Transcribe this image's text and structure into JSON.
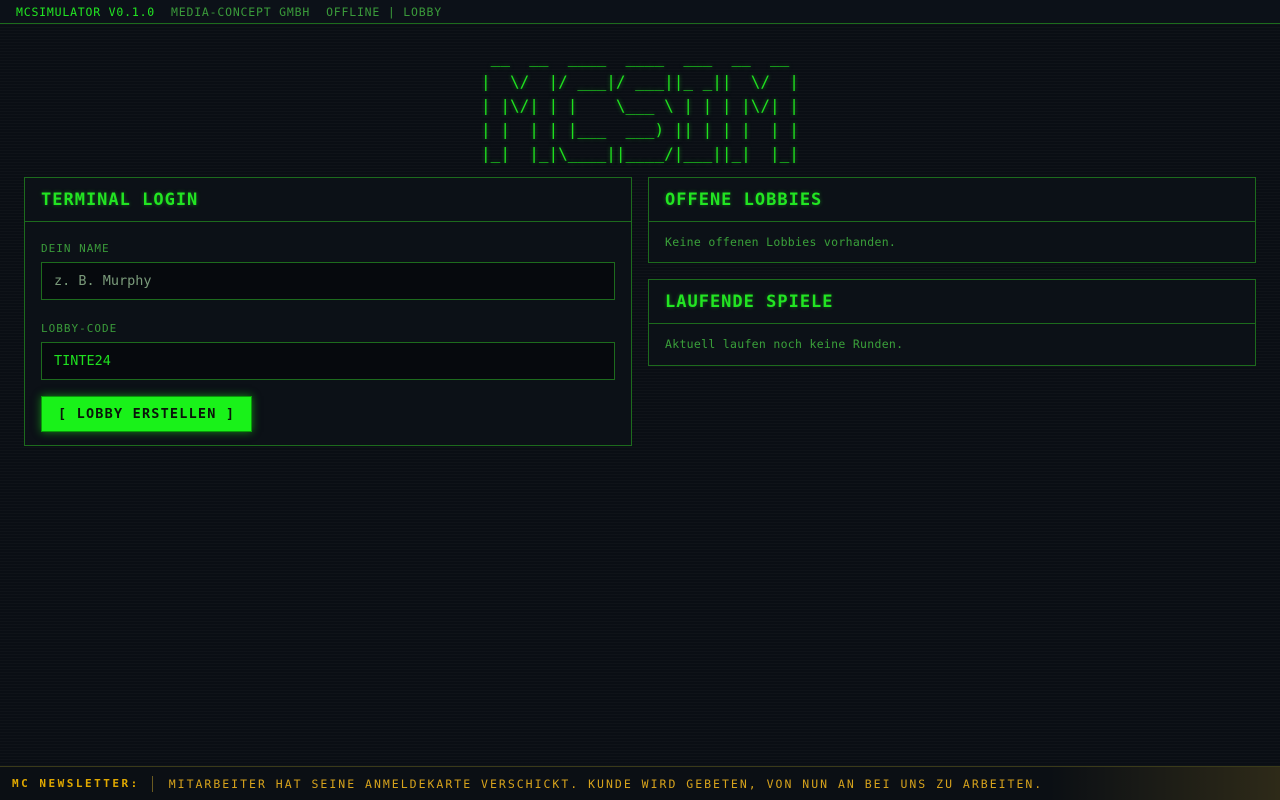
{
  "topbar": {
    "app_name": "MCSIMULATOR V0.1.0",
    "company": "MEDIA-CONCEPT GMBH",
    "status": "OFFLINE | LOBBY"
  },
  "logo": {
    "ascii": " __  __  ____  ____  ___  __  __ \n|  \\/  |/ ___|/ ___||_ _||  \\/  |\n| |\\/| | |    \\___ \\ | | | |\\/| |\n| |  | | |___  ___) || | | |  | |\n|_|  |_|\\____||____/|___||_|  |_|"
  },
  "login": {
    "title": "TERMINAL LOGIN",
    "name_label": "DEIN NAME",
    "name_placeholder": "z. B. Murphy",
    "name_value": "",
    "code_label": "LOBBY-CODE",
    "code_value": "TINTE24",
    "create_button": "[ LOBBY ERSTELLEN ]"
  },
  "lobbies": {
    "title": "OFFENE LOBBIES",
    "empty": "Keine offenen Lobbies vorhanden."
  },
  "games": {
    "title": "LAUFENDE SPIELE",
    "empty": "Aktuell laufen noch keine Runden."
  },
  "newsletter": {
    "label": "MC NEWSLETTER:",
    "text": "MITARBEITER HAT SEINE ANMELDEKARTE VERSCHICKT. KUNDE WIRD GEBETEN, VON NUN AN BEI UNS ZU ARBEITEN."
  },
  "colors": {
    "accent": "#1fe01f",
    "border": "#1d6b1d",
    "background": "#0a0e14",
    "news": "#d6a21c"
  }
}
